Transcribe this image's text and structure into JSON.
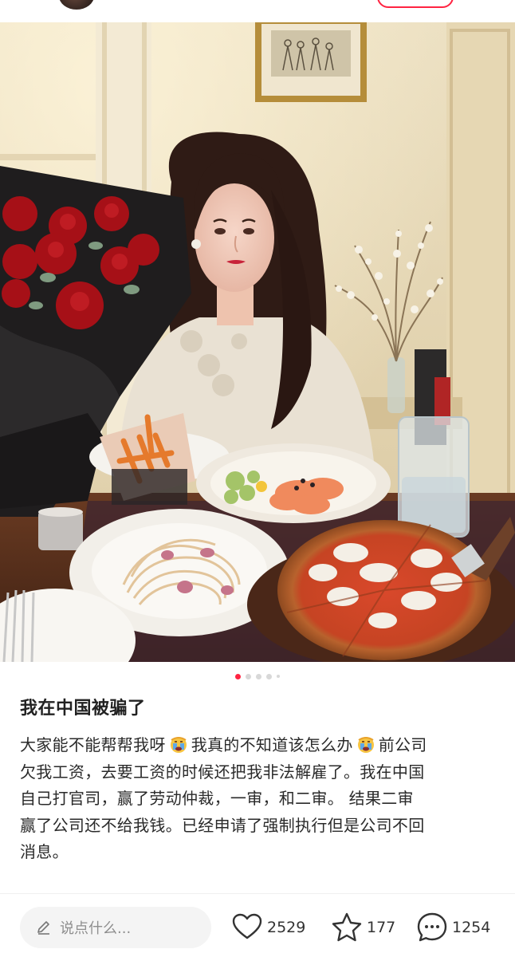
{
  "post": {
    "title": "我在中国被骗了",
    "lines": [
      [
        "大家能不能帮帮我呀",
        "我真的不知道该怎么办",
        "前公司"
      ],
      "欠我工资，去要工资的时候还把我非法解雇了。我在中国",
      "自己打官司，赢了劳动仲裁，一审，和二审。 结果二审",
      "赢了公司还不给我钱。已经申请了强制执行但是公司不回",
      "消息。"
    ],
    "inline_emoji": "crying-face-emoji"
  },
  "carousel": {
    "total": 5,
    "active_index": 0
  },
  "bottom_bar": {
    "comment_placeholder": "说点什么...",
    "likes": "2529",
    "stars": "177",
    "comments": "1254"
  },
  "colors": {
    "accent": "#ff2442",
    "text": "#222222",
    "muted": "#8e8e8e",
    "input_bg": "#f4f4f4"
  }
}
